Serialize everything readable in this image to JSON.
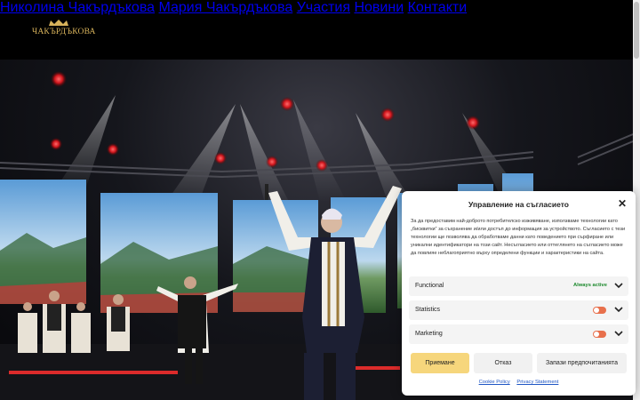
{
  "header": {
    "logo_text": "ЧАКЪРДЪКОВА",
    "nav": [
      "Николина Чакърдъкова",
      "Мария Чакърдъкова",
      "Участия",
      "Новини",
      "Контакти"
    ]
  },
  "consent": {
    "title": "Управление на съгласието",
    "body": "За да предоставим най-доброто потребителско изживяване, използваме технологии като „бисквитки“ за съхранение и/или достъп до информация за устройството. Съгласието с тези технологии ще позволява да обработваме данни като поведението при сърфиране или уникални идентификатори на този сайт. Несъгласието или оттеглянето на съгласието може да повлияе неблагоприятно върху определени функции и характеристики на сайта.",
    "categories": [
      {
        "name": "Functional",
        "status": "Always active"
      },
      {
        "name": "Statistics"
      },
      {
        "name": "Marketing"
      }
    ],
    "buttons": {
      "accept": "Приемане",
      "deny": "Отказ",
      "save": "Запази предпочитанията"
    },
    "links": {
      "cookie_policy": "Cookie Policy",
      "privacy": "Privacy Statement"
    }
  },
  "colors": {
    "gold": "#e2bd62",
    "accept": "#f6d67c",
    "toggle_off": "#e8704c",
    "active": "#1e8a2e"
  }
}
